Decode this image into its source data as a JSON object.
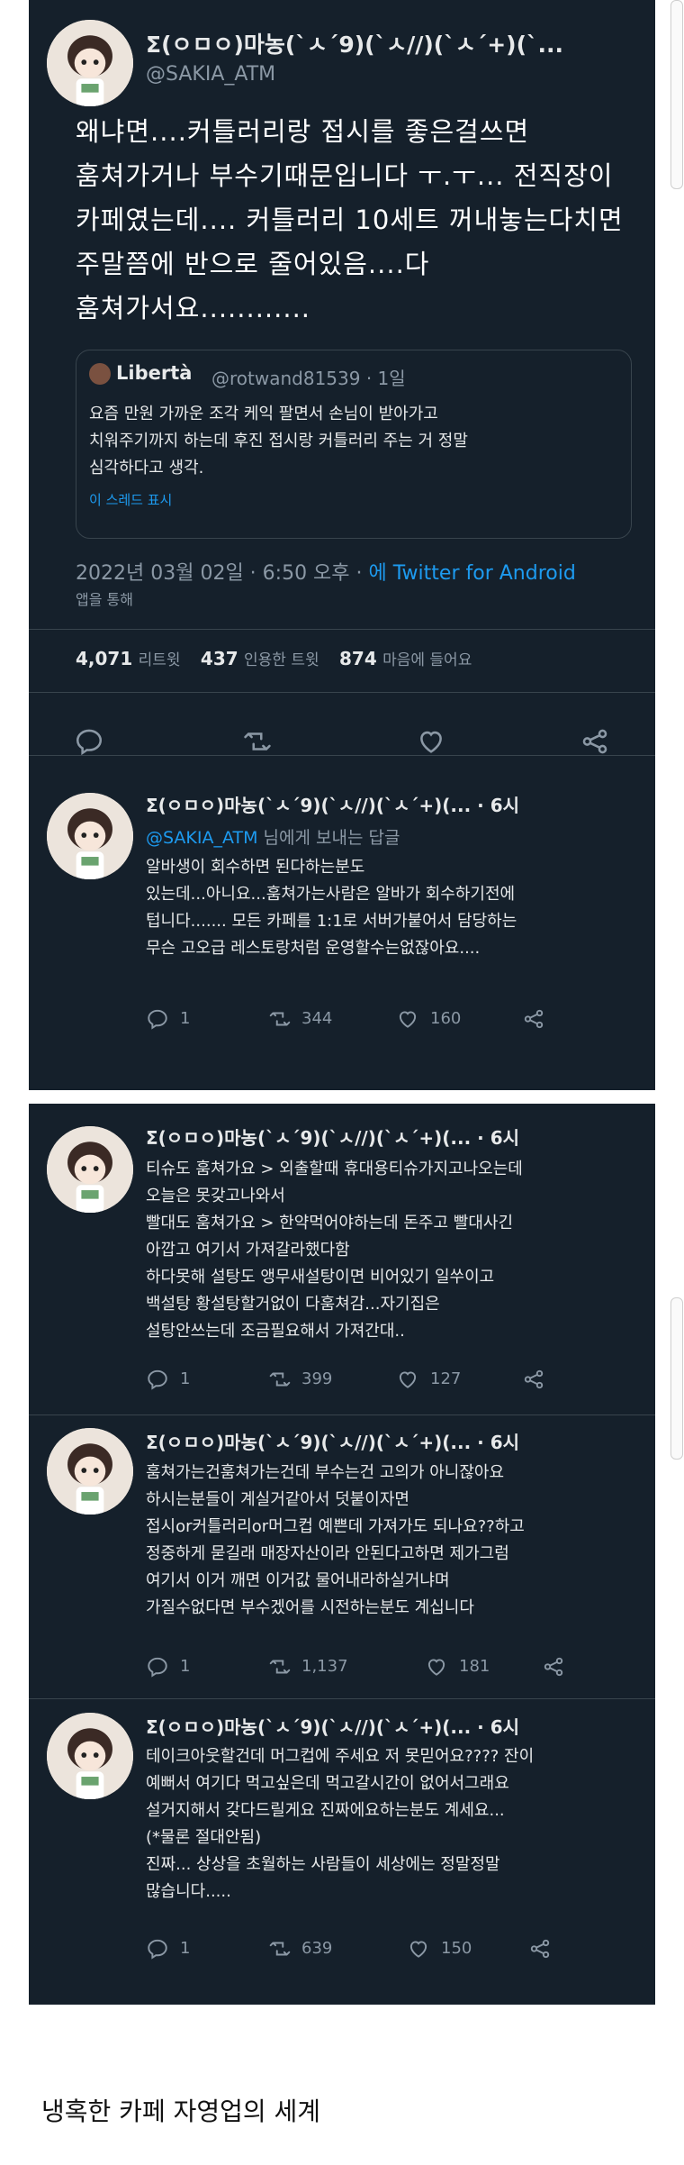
{
  "main_tweet": {
    "author_name": "Σ(ㅇㅁㅇ)마농(`ㅅ´9)(`ㅅ//)(`ㅅ´+)(`...",
    "handle": "@SAKIA_ATM",
    "text_lines": [
      "왜냐면....커틀러리랑 접시를 좋은걸쓰면",
      "훔쳐가거나 부수기때문입니다 ㅜ.ㅜ... 전직장이",
      "카페였는데.... 커틀러리 10세트 꺼내놓는다치면",
      "주말쯤에 반으로 줄어있음....다",
      "훔쳐가서요............"
    ],
    "quoted": {
      "name": "Libertà",
      "handle_date": "@rotwand81539 · 1일",
      "text_lines": [
        "요즘 만원 가까운 조각 케익 팔면서 손님이 받아가고",
        "치워주기까지 하는데 후진 접시랑 커틀러리 주는 거 정말",
        "심각하다고 생각."
      ],
      "show_thread": "이 스레드 표시"
    },
    "timestamp": "2022년 03월 02일 · 6:50 오후 · ",
    "via": "에 Twitter for Android",
    "via_suffix": "앱을 통해",
    "stats": {
      "retweets": "4,071",
      "retweets_label": "리트윗",
      "quotes": "437",
      "quotes_label": "인용한 트윗",
      "likes": "874",
      "likes_label": "마음에 들어요"
    }
  },
  "replies": [
    {
      "author_name": "Σ(ㅇㅁㅇ)마농(`ㅅ´9)(`ㅅ//)(`ㅅ´+)(... · 6시",
      "mention": "@SAKIA_ATM",
      "mention_suffix": "님에게 보내는 답글",
      "text_lines": [
        "알바생이 회수하면 된다하는분도",
        "있는데...아니요...훔쳐가는사람은 알바가 회수하기전에",
        "텁니다....... 모든 카페를 1:1로 서버가붙어서 담당하는",
        "무슨 고오급 레스토랑처럼 운영할수는없잖아요...."
      ],
      "replies": "1",
      "retweets": "344",
      "likes": "160"
    },
    {
      "author_name": "Σ(ㅇㅁㅇ)마농(`ㅅ´9)(`ㅅ//)(`ㅅ´+)(... · 6시",
      "text_lines": [
        "티슈도 훔쳐가요 > 외출할때 휴대용티슈가지고나오는데",
        "오늘은 못갖고나와서",
        "빨대도 훔쳐가요 > 한약먹어야하는데 돈주고 빨대사긴",
        "아깝고 여기서 가져갈라했다함",
        "하다못해 설탕도 앵무새설탕이면 비어있기 일쑤이고",
        "백설탕 황설탕할거없이 다훔쳐감...자기집은",
        "설탕안쓰는데 조금필요해서 가져간대.."
      ],
      "replies": "1",
      "retweets": "399",
      "likes": "127"
    },
    {
      "author_name": "Σ(ㅇㅁㅇ)마농(`ㅅ´9)(`ㅅ//)(`ㅅ´+)(... · 6시",
      "text_lines": [
        "훔쳐가는건훔쳐가는건데 부수는건 고의가 아니잖아요",
        "하시는분들이 계실거같아서 덧붙이자면",
        "접시or커틀러리or머그컵 예쁜데 가져가도 되나요??하고",
        "정중하게 묻길래 매장자산이라 안된다고하면 제가그럼",
        "여기서 이거 깨면 이거값 물어내라하실거냐며",
        "가질수없다면 부수겠어를 시전하는분도 계십니다"
      ],
      "replies": "1",
      "retweets": "1,137",
      "likes": "181"
    },
    {
      "author_name": "Σ(ㅇㅁㅇ)마농(`ㅅ´9)(`ㅅ//)(`ㅅ´+)(... · 6시",
      "text_lines": [
        "테이크아웃할건데 머그컵에 주세요 저 못믿어요???? 잔이",
        "예뻐서 여기다 먹고싶은데 먹고갈시간이 없어서그래요",
        "설거지해서 갖다드릴게요 진짜에요하는분도 계세요...",
        "(*물론 절대안됨)",
        "진짜... 상상을 초월하는 사람들이 세상에는 정말정말",
        "많습니다....."
      ],
      "replies": "1",
      "retweets": "639",
      "likes": "150"
    }
  ],
  "caption": "냉혹한 카페 자영업의 세계",
  "colors": {
    "background": "#15202b",
    "text": "#e7e9ea",
    "muted": "#8b98a5",
    "accent": "#1d9bf0",
    "border": "#38444d"
  },
  "icons": [
    "reply-icon",
    "retweet-icon",
    "like-icon",
    "share-icon",
    "more-icon"
  ]
}
